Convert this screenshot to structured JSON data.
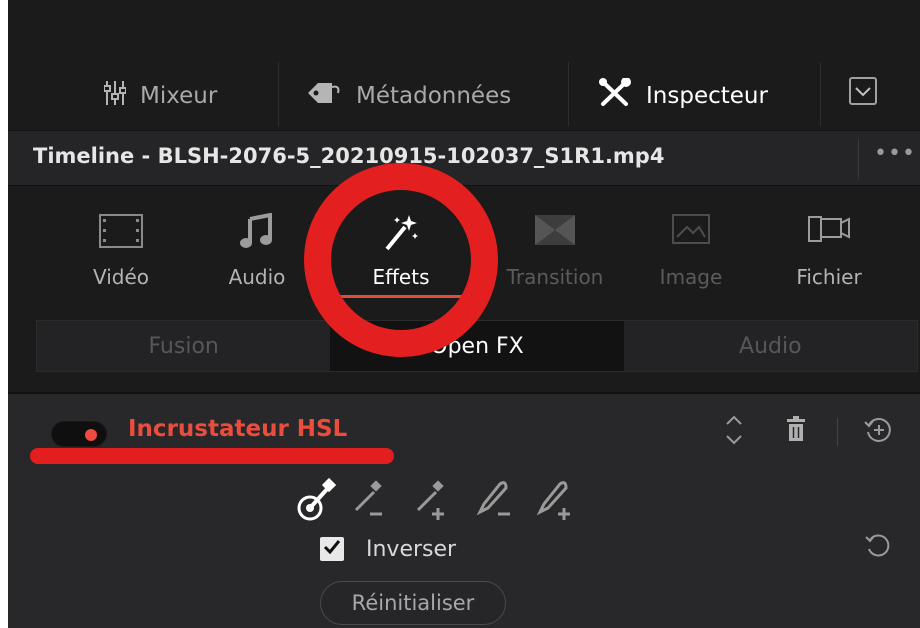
{
  "toolbar": {
    "mixer_label": "Mixeur",
    "metadata_label": "Métadonnées",
    "inspector_label": "Inspecteur"
  },
  "timeline": {
    "title": "Timeline - BLSH-2076-5_20210915-102037_S1R1.mp4",
    "more": "•••"
  },
  "tabs": [
    {
      "label": "Vidéo",
      "icon": "film-icon"
    },
    {
      "label": "Audio",
      "icon": "music-note-icon"
    },
    {
      "label": "Effets",
      "icon": "magic-wand-icon"
    },
    {
      "label": "Transition",
      "icon": "transition-icon"
    },
    {
      "label": "Image",
      "icon": "image-icon"
    },
    {
      "label": "Fichier",
      "icon": "camera-file-icon"
    }
  ],
  "subtabs": [
    "Fusion",
    "Open FX",
    "Audio"
  ],
  "effect": {
    "name": "Incrustateur HSL",
    "enabled": true,
    "invert_label": "Inverser",
    "invert_checked": true,
    "reset_label": "Réinitialiser"
  },
  "colors": {
    "accent": "#e14b3b",
    "annotation": "#e41f20",
    "background": "#1b1b1c"
  }
}
